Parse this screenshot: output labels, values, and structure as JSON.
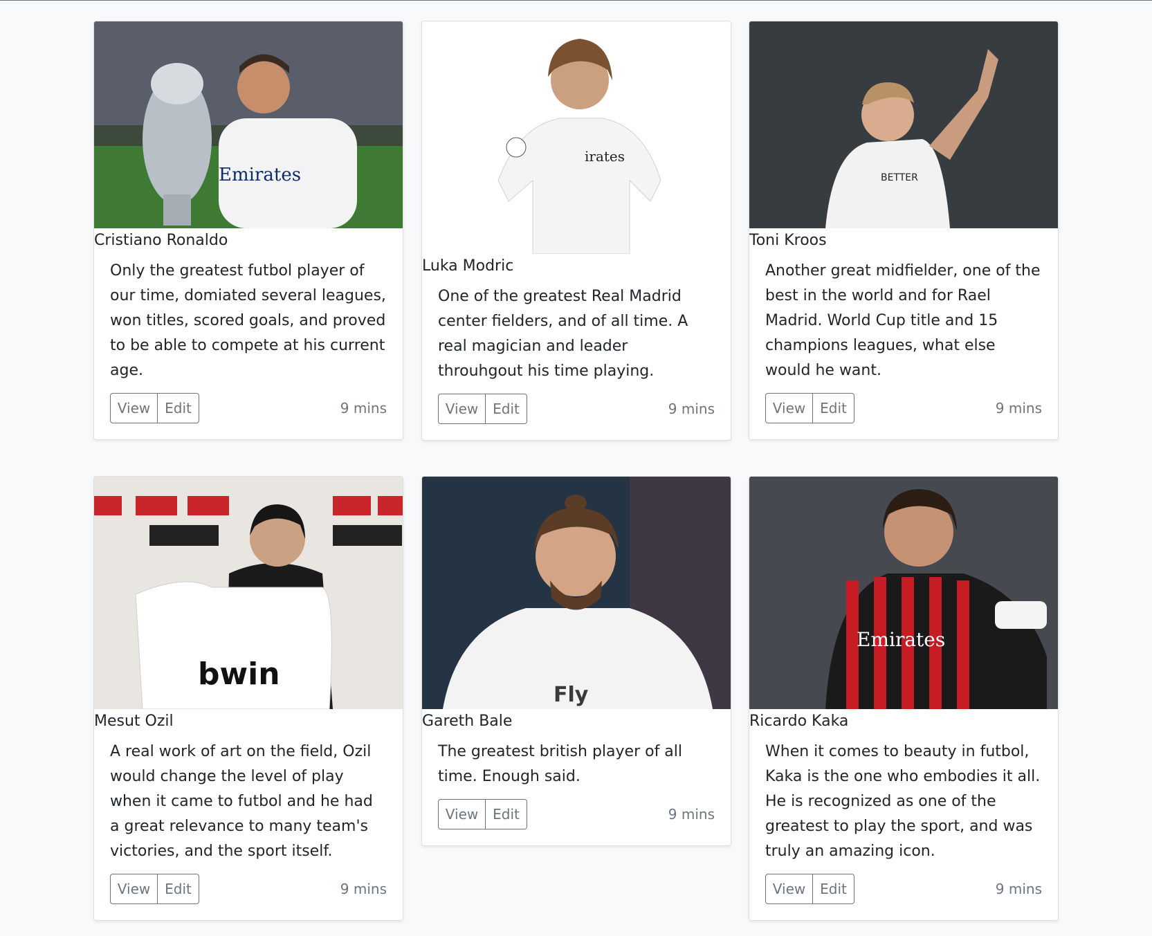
{
  "cards": [
    {
      "name": "Cristiano Ronaldo",
      "description": "Only the greatest futbol player of our time, domiated several leagues, won titles, scored goals, and proved to be able to compete at his current age.",
      "view_label": "View",
      "edit_label": "Edit",
      "time": "9 mins",
      "photo_alt": "cristiano-ronaldo-photo"
    },
    {
      "name": "Luka Modric",
      "description": "One of the greatest Real Madrid center fielders, and of all time. A real magician and leader throuhgout his time playing.",
      "view_label": "View",
      "edit_label": "Edit",
      "time": "9 mins",
      "photo_alt": "luka-modric-photo"
    },
    {
      "name": "Toni Kroos",
      "description": "Another great midfielder, one of the best in the world and for Rael Madrid. World Cup title and 15 champions leagues, what else would he want.",
      "view_label": "View",
      "edit_label": "Edit",
      "time": "9 mins",
      "photo_alt": "toni-kroos-photo"
    },
    {
      "name": "Mesut Ozil",
      "description": "A real work of art on the field, Ozil would change the level of play when it came to futbol and he had a great relevance to many team's victories, and the sport itself.",
      "view_label": "View",
      "edit_label": "Edit",
      "time": "9 mins",
      "photo_alt": "mesut-ozil-photo"
    },
    {
      "name": "Gareth Bale",
      "description": "The greatest british player of all time. Enough said.",
      "view_label": "View",
      "edit_label": "Edit",
      "time": "9 mins",
      "photo_alt": "gareth-bale-photo"
    },
    {
      "name": "Ricardo Kaka",
      "description": "When it comes to beauty in futbol, Kaka is the one who embodies it all. He is recognized as one of the greatest to play the sport, and was truly an amazing icon.",
      "view_label": "View",
      "edit_label": "Edit",
      "time": "9 mins",
      "photo_alt": "ricardo-kaka-photo"
    }
  ],
  "colors": {
    "page_bg": "#f8f9fa",
    "card_bg": "#ffffff",
    "button_border": "#6c757d",
    "muted_text": "#6c757d"
  }
}
